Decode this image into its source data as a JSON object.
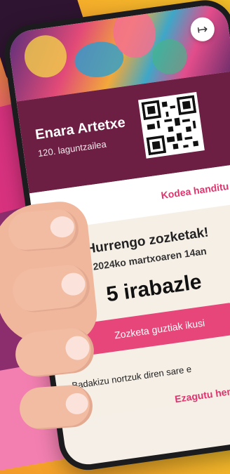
{
  "card": {
    "member_name": "Enara Artetxe",
    "member_number": "120. laguntzailea",
    "logout_icon": "logout-icon"
  },
  "expand": {
    "label": "Kodea handitu",
    "icon": "expand-icon"
  },
  "raffle": {
    "title": "Hurrengo zozketak!",
    "date": "2024ko martxoaren 14an",
    "winners": "5 irabazle",
    "button_label": "Zozketa guztiak ikusi",
    "info_text": "Badakizu nortzuk diren sare e",
    "learn_more": "Ezagutu hemen →"
  },
  "colors": {
    "card": "#6d1e43",
    "accent": "#e6467a",
    "link": "#e0336f"
  }
}
